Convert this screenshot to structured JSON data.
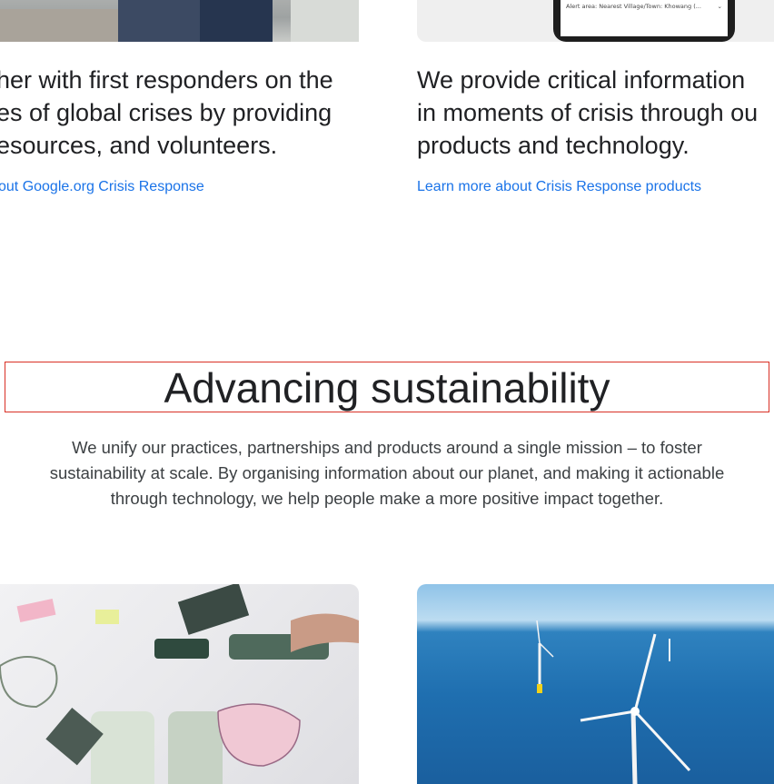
{
  "top_left": {
    "text_lines": [
      "her with first responders on the",
      "es of global crises by providing",
      "esources, and volunteers."
    ],
    "link": "out Google.org Crisis Response"
  },
  "top_right": {
    "phone_alert": "Alert area: Nearest Village/Town: Khowang (...",
    "text_lines": [
      "We provide critical information",
      "in moments of crisis through ou",
      "products and technology."
    ],
    "link": "Learn more about Crisis Response products"
  },
  "section": {
    "title": "Advancing sustainability",
    "description_lines": [
      "We unify our practices, partnerships and products around a single mission – to foster",
      "sustainability at scale. By organising information about our planet, and making it actionable",
      "through technology, we help people make a more positive impact together."
    ]
  },
  "colors": {
    "link": "#1a73e8",
    "text": "#202124",
    "highlight_border": "#d93025"
  }
}
